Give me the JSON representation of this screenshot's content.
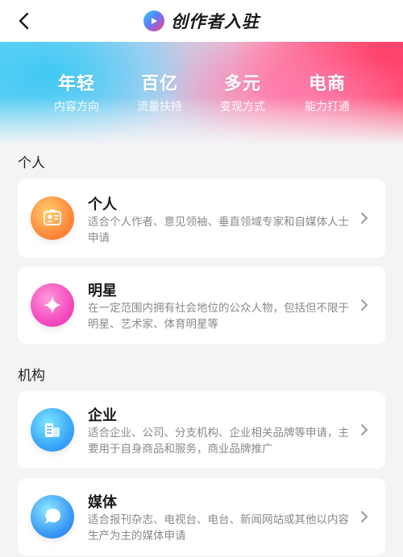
{
  "nav": {
    "title": "创作者入驻"
  },
  "banner": {
    "features": [
      {
        "big": "年轻",
        "small": "内容方向"
      },
      {
        "big": "百亿",
        "small": "流量扶持"
      },
      {
        "big": "多元",
        "small": "变现方式"
      },
      {
        "big": "电商",
        "small": "能力打通"
      }
    ]
  },
  "sections": {
    "personal": {
      "title": "个人",
      "cards": [
        {
          "title": "个人",
          "desc": "适合个人作者、意见领袖、垂直领域专家和自媒体人士申请",
          "icon": "id-badge-icon"
        },
        {
          "title": "明星",
          "desc": "在一定范围内拥有社会地位的公众人物，包括但不限于明星、艺术家、体育明星等",
          "icon": "sparkle-star-icon"
        }
      ]
    },
    "org": {
      "title": "机构",
      "cards": [
        {
          "title": "企业",
          "desc": "适合企业、公司、分支机构、企业相关品牌等申请，主要用于自身商品和服务，商业品牌推广",
          "icon": "building-icon"
        },
        {
          "title": "媒体",
          "desc": "适合报刊杂志、电视台、电台、新闻网站或其他以内容生产为主的媒体申请",
          "icon": "speech-bubble-icon"
        }
      ]
    }
  },
  "colors": {
    "accent_pink": "#ff3d7f",
    "accent_blue": "#34d2f5",
    "card_bg": "#ffffff",
    "page_bg": "#f4f4f6"
  }
}
